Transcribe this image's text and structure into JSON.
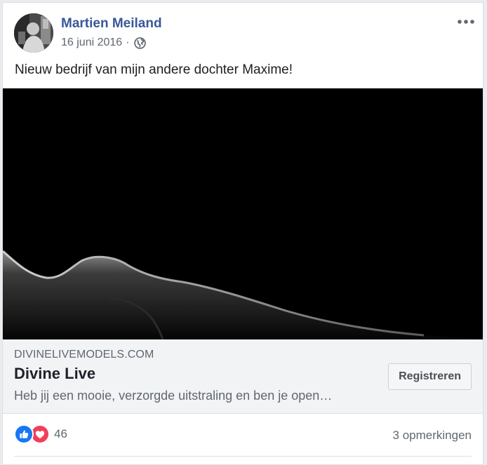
{
  "post": {
    "author": "Martien Meiland",
    "date": "16 juni 2016",
    "separator": "·",
    "privacy_icon": "globe-icon",
    "text": "Nieuw bedrijf van mijn andere dochter Maxime!"
  },
  "link_preview": {
    "domain": "DIVINELIVEMODELS.COM",
    "title": "Divine Live",
    "description": "Heb jij een mooie, verzorgde uitstraling en ben je open…",
    "cta_label": "Registreren"
  },
  "engagement": {
    "reaction_icons": [
      "like-icon",
      "love-icon"
    ],
    "reaction_count": "46",
    "comments": "3 opmerkingen"
  },
  "colors": {
    "author_link": "#385898",
    "like": "#1877f2",
    "love": "#f33e58",
    "muted_text": "#606770"
  }
}
